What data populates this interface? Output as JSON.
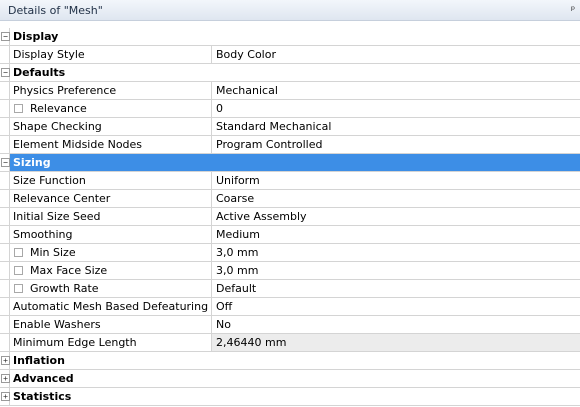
{
  "title": "Details of \"Mesh\"",
  "pin_glyph": "ᵖ",
  "sections": [
    {
      "id": "display",
      "label": "Display",
      "expander": "−",
      "expanded": true,
      "rows": [
        {
          "label": "Display Style",
          "value": "Body Color"
        }
      ]
    },
    {
      "id": "defaults",
      "label": "Defaults",
      "expander": "−",
      "expanded": true,
      "rows": [
        {
          "label": "Physics Preference",
          "value": "Mechanical"
        },
        {
          "label": "Relevance",
          "value": "0",
          "checkbox": true
        },
        {
          "label": "Shape Checking",
          "value": "Standard Mechanical"
        },
        {
          "label": "Element Midside Nodes",
          "value": "Program Controlled"
        }
      ]
    },
    {
      "id": "sizing",
      "label": "Sizing",
      "expander": "−",
      "expanded": true,
      "selected": true,
      "rows": [
        {
          "label": "Size Function",
          "value": "Uniform"
        },
        {
          "label": "Relevance Center",
          "value": "Coarse"
        },
        {
          "label": "Initial Size Seed",
          "value": "Active Assembly"
        },
        {
          "label": "Smoothing",
          "value": "Medium"
        },
        {
          "label": "Min Size",
          "value": "3,0 mm",
          "checkbox": true
        },
        {
          "label": "Max Face Size",
          "value": "3,0 mm",
          "checkbox": true
        },
        {
          "label": "Growth Rate",
          "value": "Default",
          "checkbox": true
        },
        {
          "label": "Automatic Mesh Based Defeaturing",
          "value": "Off"
        },
        {
          "label": "Enable Washers",
          "value": "No"
        },
        {
          "label": "Minimum Edge Length",
          "value": "2,46440 mm",
          "readonly": true
        }
      ]
    },
    {
      "id": "inflation",
      "label": "Inflation",
      "expander": "+",
      "expanded": false,
      "rows": []
    },
    {
      "id": "advanced",
      "label": "Advanced",
      "expander": "+",
      "expanded": false,
      "rows": []
    },
    {
      "id": "statistics",
      "label": "Statistics",
      "expander": "+",
      "expanded": false,
      "rows": []
    }
  ]
}
